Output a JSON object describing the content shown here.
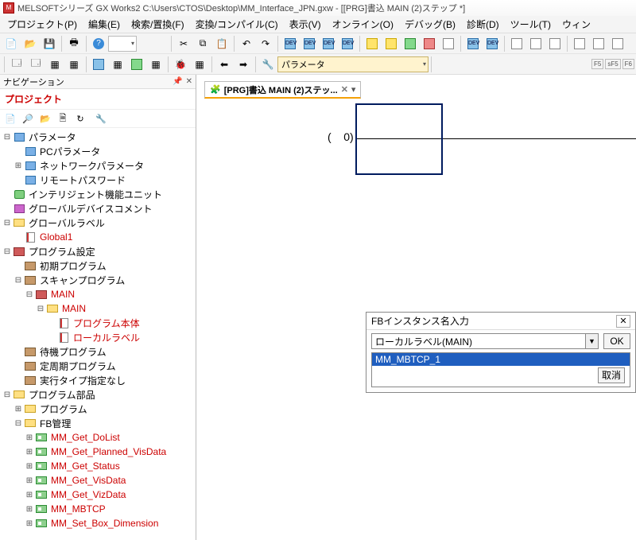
{
  "title": "MELSOFTシリーズ GX Works2 C:\\Users\\CTOS\\Desktop\\MM_Interface_JPN.gxw - [[PRG]書込 MAIN (2)ステップ *]",
  "menu": {
    "project": "プロジェクト(P)",
    "edit": "編集(E)",
    "search": "検索/置換(F)",
    "convert": "変換/コンパイル(C)",
    "view": "表示(V)",
    "online": "オンライン(O)",
    "debug": "デバッグ(B)",
    "diag": "診断(D)",
    "tool": "ツール(T)",
    "window": "ウィン"
  },
  "param_combo": "パラメータ",
  "nav": {
    "title": "ナビゲーション",
    "project": "プロジェクト",
    "items": {
      "param": "パラメータ",
      "pc_param": "PCパラメータ",
      "net_param": "ネットワークパラメータ",
      "remote_pw": "リモートパスワード",
      "intelli": "インテリジェント機能ユニット",
      "gdev_comment": "グローバルデバイスコメント",
      "glabel": "グローバルラベル",
      "global1": "Global1",
      "prog_setting": "プログラム設定",
      "init_prog": "初期プログラム",
      "scan_prog": "スキャンプログラム",
      "main1": "MAIN",
      "main2": "MAIN",
      "prog_body": "プログラム本体",
      "local_label": "ローカルラベル",
      "standby": "待機プログラム",
      "fixed": "定周期プログラム",
      "exec_none": "実行タイプ指定なし",
      "prog_parts": "プログラム部品",
      "program": "プログラム",
      "fb_mgmt": "FB管理",
      "fb1": "MM_Get_DoList",
      "fb2": "MM_Get_Planned_VisData",
      "fb3": "MM_Get_Status",
      "fb4": "MM_Get_VisData",
      "fb5": "MM_Get_VizData",
      "fb6": "MM_MBTCP",
      "fb7": "MM_Set_Box_Dimension"
    }
  },
  "doc_tab": "[PRG]書込 MAIN (2)ステッ...",
  "ladder_step": "0",
  "dialog": {
    "title": "FBインスタンス名入力",
    "combo": "ローカルラベル(MAIN)",
    "ok": "OK",
    "cancel": "取消",
    "selected": "MM_MBTCP_1"
  },
  "fkeys": [
    "F5",
    "sF5",
    "F6"
  ]
}
